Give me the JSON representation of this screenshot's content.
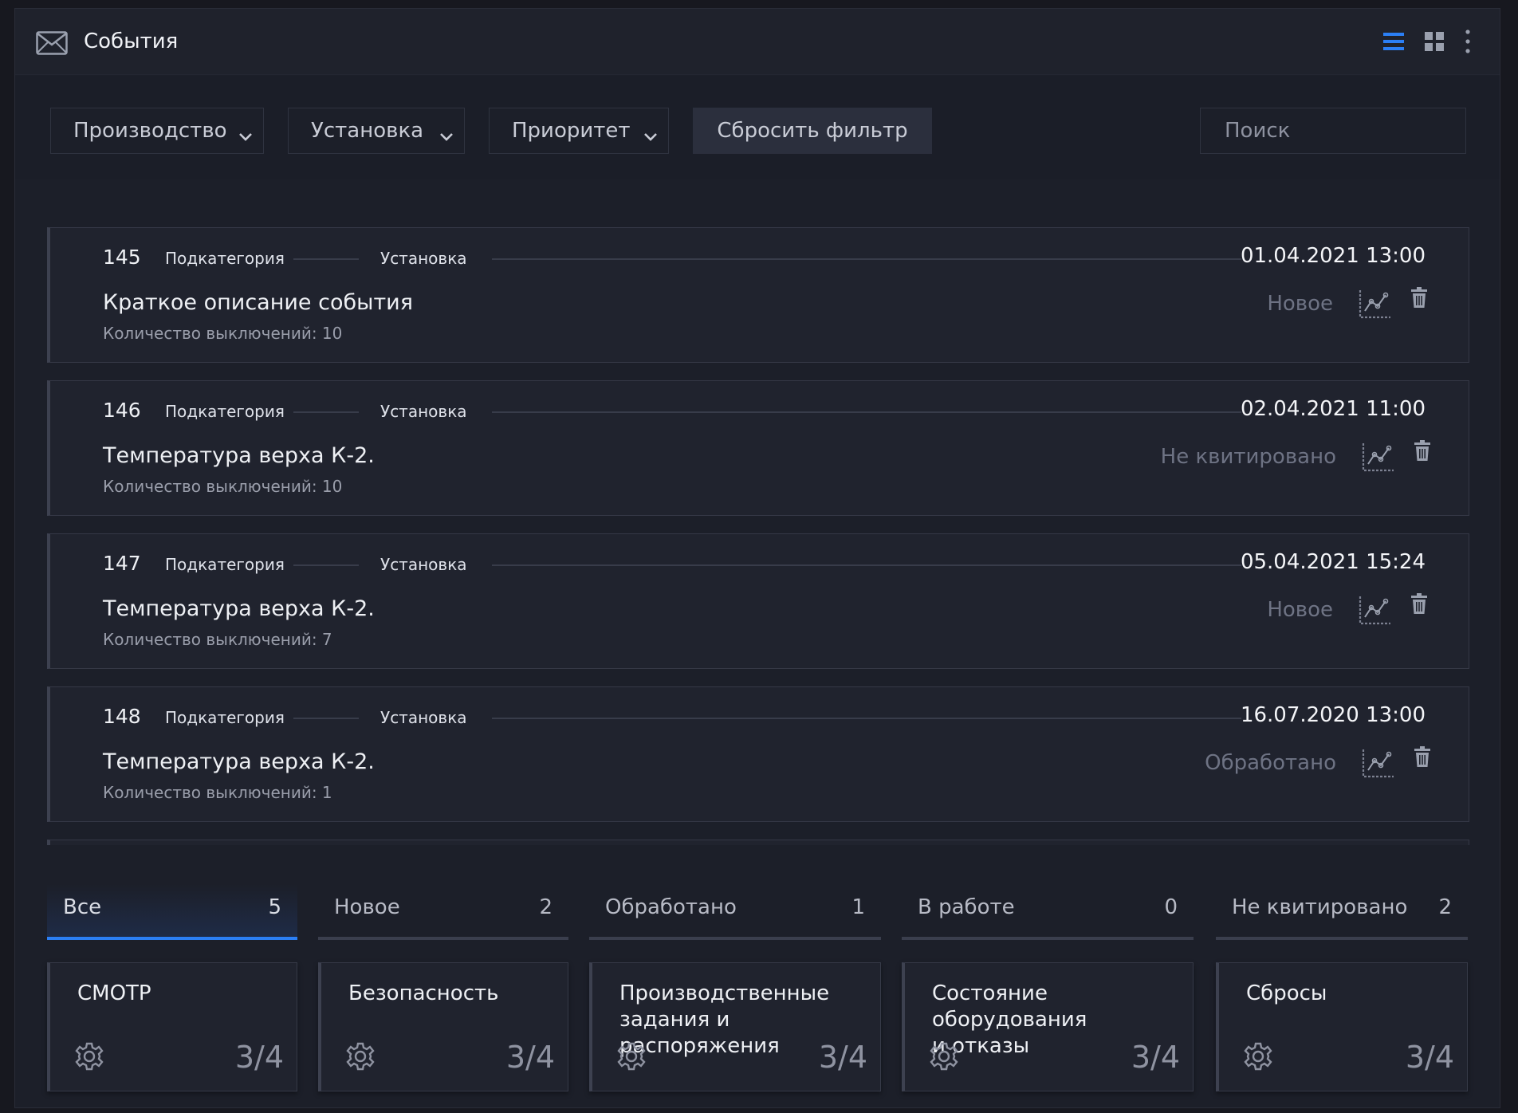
{
  "header": {
    "title": "События",
    "icons": [
      "mail-icon",
      "list-view-icon",
      "grid-view-icon",
      "more-icon"
    ],
    "accent": "#2b7ff5"
  },
  "filters": {
    "production": "Производство",
    "installation": "Установка",
    "priority": "Приоритет",
    "reset": "Сбросить фильтр",
    "search_placeholder": "Поиск"
  },
  "events": [
    {
      "id": "145",
      "subcategory": "Подкатегория",
      "installation": "Установка",
      "date": "01.04.2021 13:00",
      "description": "Краткое описание события",
      "count": "Количество выключений: 10",
      "status": "Новое"
    },
    {
      "id": "146",
      "subcategory": "Подкатегория",
      "installation": "Установка",
      "date": "02.04.2021 11:00",
      "description": "Температура верха К-2.",
      "count": "Количество выключений: 10",
      "status": "Не квитировано"
    },
    {
      "id": "147",
      "subcategory": "Подкатегория",
      "installation": "Установка",
      "date": "05.04.2021 15:24",
      "description": "Температура верха К-2.",
      "count": "Количество выключений: 7",
      "status": "Новое"
    },
    {
      "id": "148",
      "subcategory": "Подкатегория",
      "installation": "Установка",
      "date": "16.07.2020 13:00",
      "description": "Температура верха К-2.",
      "count": "Количество выключений: 1",
      "status": "Обработано"
    }
  ],
  "tabs": [
    {
      "label": "Все",
      "count": "5",
      "active": true
    },
    {
      "label": "Новое",
      "count": "2"
    },
    {
      "label": "Обработано",
      "count": "1"
    },
    {
      "label": "В работе",
      "count": "0"
    },
    {
      "label": "Не квитировано",
      "count": "2"
    }
  ],
  "categories": [
    {
      "name": "СМОТР",
      "value": "3/4"
    },
    {
      "name": "Безопасность",
      "value": "3/4"
    },
    {
      "name": "Производственные\nзадания и распоряжения",
      "value": "3/4"
    },
    {
      "name": "Состояние оборудования\nи отказы",
      "value": "3/4"
    },
    {
      "name": "Сбросы",
      "value": "3/4"
    }
  ]
}
